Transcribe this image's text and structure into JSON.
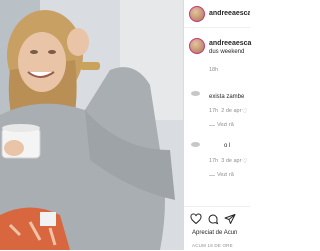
{
  "post": {
    "username": "andreeaesca",
    "caption_username": "andreeaesca",
    "caption_text": "dus weekend",
    "caption_time": "18h",
    "likes_text": "Apreciat de Acun",
    "date_text": "ACUM 18 DE ORE"
  },
  "comments": [
    {
      "text": "exista zambe",
      "time": "17h",
      "date": "2 de apr",
      "reply": "Vezi ră"
    },
    {
      "text": "o l",
      "time": "17h",
      "date": "3 de apr",
      "reply": "Vezi ră"
    }
  ],
  "icons": [
    "heart-icon",
    "comment-icon",
    "share-icon"
  ],
  "colors": {
    "accent": "#262626",
    "muted": "#8e8e8e",
    "border": "#dbdbdb"
  }
}
